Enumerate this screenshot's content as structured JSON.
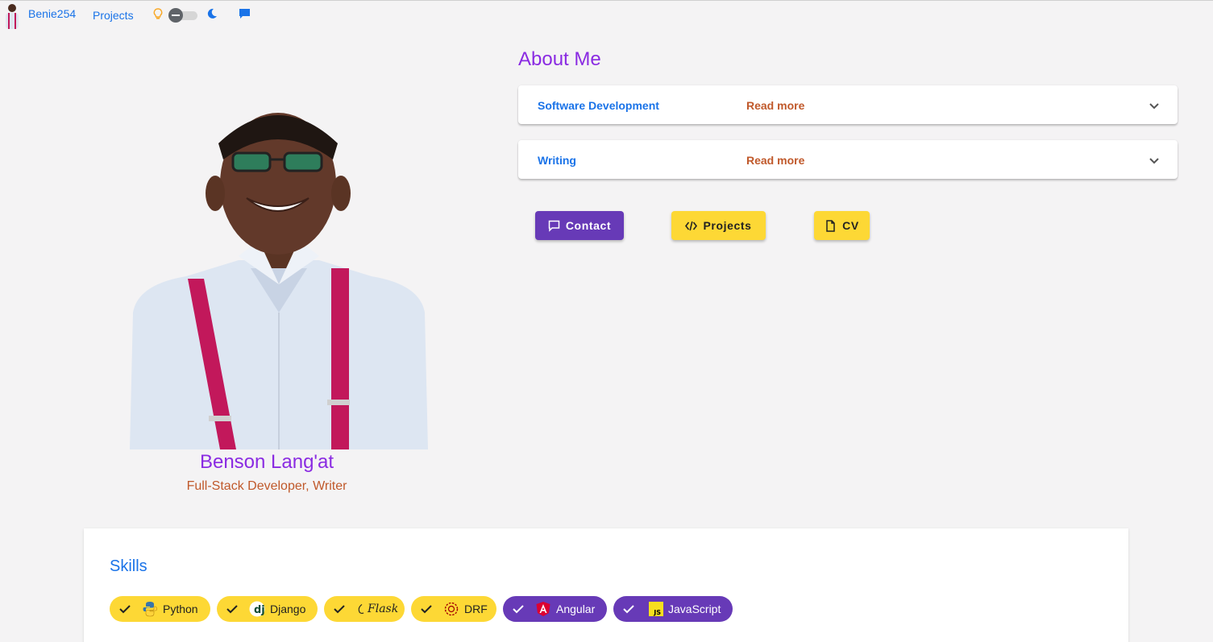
{
  "nav": {
    "brand": "Benie254",
    "projects_link": "Projects",
    "icons": [
      "avatar",
      "lightbulb-icon",
      "theme-toggle",
      "moon-icon",
      "chat-icon"
    ]
  },
  "profile": {
    "name": "Benson Lang'at",
    "role": "Full-Stack Developer, Writer"
  },
  "about": {
    "title": "About Me",
    "panels": [
      {
        "title": "Software Development",
        "description": "Read more"
      },
      {
        "title": "Writing",
        "description": "Read more"
      }
    ]
  },
  "actions": {
    "contact": "Contact",
    "projects": "Projects",
    "cv": "CV"
  },
  "skills": {
    "title": "Skills",
    "items": [
      {
        "label": "Python",
        "icon": "python-icon",
        "color": "yellow"
      },
      {
        "label": "Django",
        "icon": "django-icon",
        "color": "yellow"
      },
      {
        "label": "Flask",
        "icon": "flask-icon",
        "color": "yellow"
      },
      {
        "label": "DRF",
        "icon": "drf-icon",
        "color": "yellow"
      },
      {
        "label": "Angular",
        "icon": "angular-icon",
        "color": "purple"
      },
      {
        "label": "JavaScript",
        "icon": "javascript-icon",
        "color": "purple"
      }
    ]
  },
  "colors": {
    "accent_purple": "#8a2be2",
    "link_blue": "#1a73e8",
    "muted_orange": "#c0592b",
    "button_purple": "#673ab7",
    "button_yellow": "#fdd835",
    "background": "#f4f3f4"
  }
}
